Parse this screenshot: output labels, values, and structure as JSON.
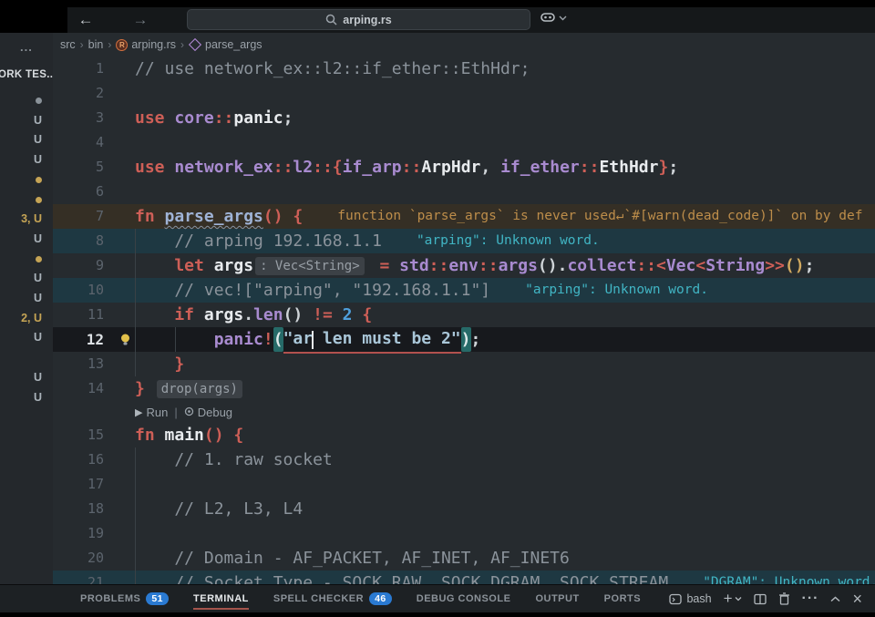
{
  "titlebar": {
    "search_value": "arping.rs"
  },
  "breadcrumbs": {
    "items": [
      {
        "label": "src"
      },
      {
        "label": "bin"
      },
      {
        "label": "arping.rs",
        "icon": "rust-file"
      },
      {
        "label": "parse_args",
        "icon": "symbol-method"
      }
    ]
  },
  "explorer": {
    "header": "ORK TES...",
    "menu_ellipsis": "...",
    "items": [
      {
        "row": 0,
        "kind": "dot",
        "variant": "gray"
      },
      {
        "row": 1,
        "kind": "badge",
        "text": "U",
        "variant": "gray"
      },
      {
        "row": 2,
        "kind": "badge",
        "text": "U",
        "variant": "gray"
      },
      {
        "row": 3,
        "kind": "badge",
        "text": "U",
        "variant": "gray"
      },
      {
        "row": 4,
        "kind": "dot",
        "variant": "yellow"
      },
      {
        "row": 5,
        "kind": "dot",
        "variant": "yellow"
      },
      {
        "row": 6,
        "kind": "badge",
        "text": "3, U",
        "variant": "yellow"
      },
      {
        "row": 7,
        "kind": "badge",
        "text": "U",
        "variant": "gray"
      },
      {
        "row": 8,
        "kind": "dot",
        "variant": "yellow"
      },
      {
        "row": 9,
        "kind": "badge",
        "text": "U",
        "variant": "gray"
      },
      {
        "row": 10,
        "kind": "badge",
        "text": "U",
        "variant": "gray"
      },
      {
        "row": 11,
        "kind": "badge",
        "text": "2, U",
        "variant": "yellow"
      },
      {
        "row": 12,
        "kind": "badge",
        "text": "U",
        "variant": "gray"
      },
      {
        "row": 14,
        "kind": "badge",
        "text": "U",
        "variant": "gray"
      },
      {
        "row": 15,
        "kind": "badge",
        "text": "U",
        "variant": "gray"
      }
    ]
  },
  "editor": {
    "lens": {
      "run_label": "Run",
      "debug_label": "Debug"
    },
    "lines": [
      {
        "num": 1,
        "tokens": [
          [
            "cm",
            "// use network_ex::l2::if_ether::EthHdr;"
          ]
        ]
      },
      {
        "num": 2,
        "tokens": []
      },
      {
        "num": 3,
        "tokens": [
          [
            "kw",
            "use "
          ],
          [
            "id",
            "core"
          ],
          [
            "op",
            "::"
          ],
          [
            "wh",
            "panic"
          ],
          [
            "pn",
            ";"
          ]
        ]
      },
      {
        "num": 4,
        "tokens": []
      },
      {
        "num": 5,
        "tokens": [
          [
            "kw",
            "use "
          ],
          [
            "id",
            "network_ex"
          ],
          [
            "op",
            "::"
          ],
          [
            "id",
            "l2"
          ],
          [
            "op",
            "::{"
          ],
          [
            "id",
            "if_arp"
          ],
          [
            "op",
            "::"
          ],
          [
            "wh",
            "ArpHdr"
          ],
          [
            "pn",
            ", "
          ],
          [
            "id",
            "if_ether"
          ],
          [
            "op",
            "::"
          ],
          [
            "wh",
            "EthHdr"
          ],
          [
            "op",
            "}"
          ],
          [
            "pn",
            ";"
          ]
        ]
      },
      {
        "num": 6,
        "tokens": []
      },
      {
        "num": 7,
        "tint": "warn",
        "tokens": [
          [
            "kw",
            "fn "
          ],
          [
            "fname",
            "parse_args"
          ],
          [
            "op",
            "()"
          ],
          [
            "pn",
            " "
          ],
          [
            "op",
            "{"
          ]
        ],
        "hint": {
          "type": "warn",
          "text": "function `parse_args` is never used↵`#[warn(dead_code)]` on by def"
        }
      },
      {
        "num": 8,
        "tint": "spell",
        "tokens": [
          [
            "cm",
            "    // arping 192.168.1.1"
          ]
        ],
        "hint": {
          "type": "spell",
          "text": "\"arping\": Unknown word."
        }
      },
      {
        "num": 9,
        "tokens": [
          [
            "kw",
            "    let "
          ],
          [
            "wh",
            "args"
          ],
          [
            "inlay",
            ": Vec<String>"
          ],
          [
            "op",
            " = "
          ],
          [
            "id",
            "std"
          ],
          [
            "op",
            "::"
          ],
          [
            "id",
            "env"
          ],
          [
            "op",
            "::"
          ],
          [
            "id",
            "args"
          ],
          [
            "pn",
            "()"
          ],
          [
            "pn",
            "."
          ],
          [
            "id",
            "collect"
          ],
          [
            "op",
            "::<"
          ],
          [
            "id",
            "Vec"
          ],
          [
            "op",
            "<"
          ],
          [
            "id",
            "String"
          ],
          [
            "op",
            ">>"
          ],
          [
            "gld",
            "()"
          ],
          [
            "pn",
            ";"
          ]
        ]
      },
      {
        "num": 10,
        "tint": "spell",
        "tokens": [
          [
            "cm",
            "    // vec![\"arping\", \"192.168.1.1\"]"
          ]
        ],
        "hint": {
          "type": "spell",
          "text": "\"arping\": Unknown word."
        }
      },
      {
        "num": 11,
        "tokens": [
          [
            "kw",
            "    if "
          ],
          [
            "wh",
            "args"
          ],
          [
            "pn",
            "."
          ],
          [
            "id",
            "len"
          ],
          [
            "pn",
            "()"
          ],
          [
            "pn",
            " "
          ],
          [
            "op",
            "!= "
          ],
          [
            "num",
            "2"
          ],
          [
            "pn",
            " "
          ],
          [
            "op",
            "{"
          ]
        ]
      },
      {
        "num": 12,
        "tint": "cur",
        "bulb": true,
        "tokens": [
          [
            "id",
            "        panic"
          ],
          [
            "op",
            "!"
          ],
          [
            "brk",
            "("
          ],
          [
            "stru",
            "\"ar"
          ],
          [
            "cursor",
            ""
          ],
          [
            "stru",
            " len must be 2\""
          ],
          [
            "brk",
            ")"
          ],
          [
            "pn",
            ";"
          ]
        ]
      },
      {
        "num": 13,
        "tokens": [
          [
            "op",
            "    }"
          ]
        ]
      },
      {
        "num": 14,
        "tokens": [
          [
            "op",
            "} "
          ],
          [
            "inlay",
            "drop(args)"
          ]
        ]
      },
      {
        "lens": true
      },
      {
        "num": 15,
        "tokens": [
          [
            "kw",
            "fn "
          ],
          [
            "wh",
            "main"
          ],
          [
            "op",
            "()"
          ],
          [
            "pn",
            " "
          ],
          [
            "op",
            "{"
          ]
        ]
      },
      {
        "num": 16,
        "tokens": [
          [
            "cm",
            "    // 1. raw socket"
          ]
        ]
      },
      {
        "num": 17,
        "tokens": []
      },
      {
        "num": 18,
        "tokens": [
          [
            "cm",
            "    // L2, L3, L4"
          ]
        ]
      },
      {
        "num": 19,
        "tokens": []
      },
      {
        "num": 20,
        "tokens": [
          [
            "cm",
            "    // Domain - AF_PACKET, AF_INET, AF_INET6"
          ]
        ]
      },
      {
        "num": 21,
        "tint": "spell",
        "tokens": [
          [
            "cm",
            "    // Socket Type - SOCK_RAW, SOCK_DGRAM, SOCK_STREAM"
          ]
        ],
        "hint": {
          "type": "spell",
          "text": "\"DGRAM\": Unknown word."
        }
      }
    ]
  },
  "panel": {
    "tabs": [
      {
        "label": "PROBLEMS",
        "badge": "51"
      },
      {
        "label": "TERMINAL",
        "active": true
      },
      {
        "label": "SPELL CHECKER",
        "badge": "46"
      },
      {
        "label": "DEBUG CONSOLE"
      },
      {
        "label": "OUTPUT"
      },
      {
        "label": "PORTS"
      }
    ],
    "terminal_profile": "bash"
  },
  "colors": {
    "editor_background": "#262b2f",
    "keyword_red": "#ce5f57",
    "identifier_purple": "#a98bd0",
    "string_blue": "#a9c6d8",
    "comment_gray": "#8b939b",
    "spell_hint_cyan": "#41b5c4",
    "warning_hint_orange": "#bd8d4a",
    "badge_blue": "#2a7ad2",
    "warning_yellow": "#c5a455",
    "active_tab_underline": "#a4544c",
    "bracket_match_teal": "#266a68"
  }
}
